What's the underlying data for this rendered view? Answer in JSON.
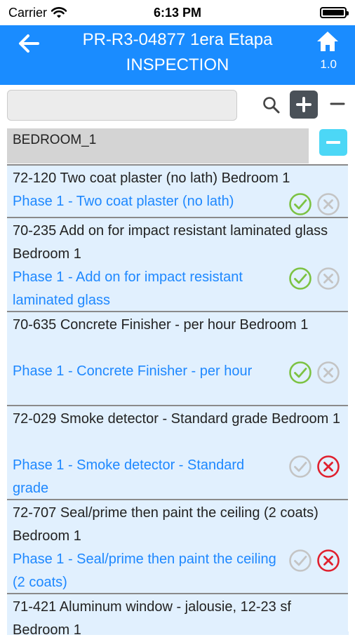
{
  "status_bar": {
    "carrier": "Carrier",
    "time": "6:13 PM"
  },
  "nav": {
    "title": "PR-R3-04877 1era Etapa",
    "subtitle": "INSPECTION",
    "version": "1.0"
  },
  "search": {
    "value": "",
    "placeholder": ""
  },
  "section": {
    "label": "BEDROOM_1"
  },
  "items": [
    {
      "title": "72-120 Two coat plaster (no lath) Bedroom 1",
      "phase": "Phase 1 - Two coat plaster (no lath)",
      "approve_active": true,
      "reject_active": false
    },
    {
      "title": "70-235 Add on for impact resistant laminated glass Bedroom 1",
      "phase": "Phase 1 - Add on for impact resistant laminated glass",
      "approve_active": true,
      "reject_active": false
    },
    {
      "title": "70-635 Concrete Finisher - per hour Bedroom 1",
      "phase": "Phase 1 - Concrete Finisher - per hour",
      "approve_active": true,
      "reject_active": false
    },
    {
      "title": "72-029 Smoke detector - Standard grade Bedroom 1",
      "phase": "Phase 1 - Smoke detector - Standard grade",
      "approve_active": false,
      "reject_active": true
    },
    {
      "title": "72-707 Seal/prime then paint the ceiling (2 coats) Bedroom 1",
      "phase": "Phase 1 - Seal/prime then paint the ceiling (2 coats)",
      "approve_active": false,
      "reject_active": true
    },
    {
      "title": "71-421 Aluminum window - jalousie, 12-23 sf Bedroom 1",
      "phase": "",
      "approve_active": false,
      "reject_active": false
    }
  ],
  "icons": {
    "back": "arrow-left-icon",
    "home": "home-icon",
    "search": "search-icon",
    "add": "plus-icon",
    "remove": "minus-icon",
    "approve": "check-circle-icon",
    "reject": "x-circle-icon"
  },
  "colors": {
    "nav_bg": "#1a8cff",
    "item_bg": "#e1f0fe",
    "phase_text": "#1e88ff",
    "approve_active": "#7cc242",
    "reject_active": "#e0202e",
    "inactive": "#c4c4c4",
    "collapse_btn": "#4cd7f6"
  }
}
